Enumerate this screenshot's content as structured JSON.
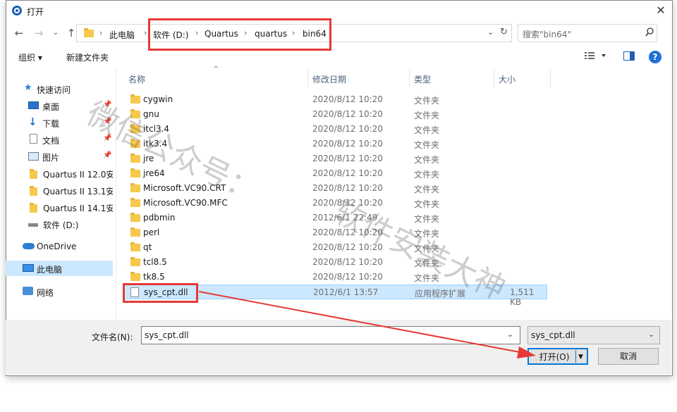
{
  "window": {
    "title": "打开"
  },
  "address": {
    "crumbs": [
      "此电脑",
      "软件 (D:)",
      "Quartus",
      "quartus",
      "bin64"
    ]
  },
  "search": {
    "placeholder": "搜索\"bin64\""
  },
  "toolbar": {
    "organize": "组织 ▾",
    "new_folder": "新建文件夹",
    "help": "?"
  },
  "sidebar": {
    "items": [
      {
        "label": "快速访问",
        "icon": "star-icon"
      },
      {
        "label": "桌面",
        "icon": "desktop-icon"
      },
      {
        "label": "下载",
        "icon": "download-icon"
      },
      {
        "label": "文档",
        "icon": "document-icon"
      },
      {
        "label": "图片",
        "icon": "picture-icon"
      },
      {
        "label": "Quartus II 12.0安装",
        "icon": "folder-icon"
      },
      {
        "label": "Quartus II 13.1安装",
        "icon": "folder-icon"
      },
      {
        "label": "Quartus II 14.1安装",
        "icon": "folder-icon"
      },
      {
        "label": "软件 (D:)",
        "icon": "drive-icon"
      },
      {
        "label": "OneDrive",
        "icon": "cloud-icon"
      },
      {
        "label": "此电脑",
        "icon": "computer-icon"
      },
      {
        "label": "网络",
        "icon": "network-icon"
      }
    ]
  },
  "columns": {
    "name": "名称",
    "date": "修改日期",
    "type": "类型",
    "size": "大小"
  },
  "files": [
    {
      "name": "cygwin",
      "date": "2020/8/12 10:20",
      "type": "文件夹",
      "size": ""
    },
    {
      "name": "gnu",
      "date": "2020/8/12 10:20",
      "type": "文件夹",
      "size": ""
    },
    {
      "name": "itcl3.4",
      "date": "2020/8/12 10:20",
      "type": "文件夹",
      "size": ""
    },
    {
      "name": "itk3.4",
      "date": "2020/8/12 10:20",
      "type": "文件夹",
      "size": ""
    },
    {
      "name": "jre",
      "date": "2020/8/12 10:20",
      "type": "文件夹",
      "size": ""
    },
    {
      "name": "jre64",
      "date": "2020/8/12 10:20",
      "type": "文件夹",
      "size": ""
    },
    {
      "name": "Microsoft.VC90.CRT",
      "date": "2020/8/12 10:20",
      "type": "文件夹",
      "size": ""
    },
    {
      "name": "Microsoft.VC90.MFC",
      "date": "2020/8/12 10:20",
      "type": "文件夹",
      "size": ""
    },
    {
      "name": "pdbmin",
      "date": "2012/6/1 22:49",
      "type": "文件夹",
      "size": ""
    },
    {
      "name": "perl",
      "date": "2020/8/12 10:20",
      "type": "文件夹",
      "size": ""
    },
    {
      "name": "qt",
      "date": "2020/8/12 10:20",
      "type": "文件夹",
      "size": ""
    },
    {
      "name": "tcl8.5",
      "date": "2020/8/12 10:20",
      "type": "文件夹",
      "size": ""
    },
    {
      "name": "tk8.5",
      "date": "2020/8/12 10:20",
      "type": "文件夹",
      "size": ""
    },
    {
      "name": "sys_cpt.dll",
      "date": "2012/6/1 13:57",
      "type": "应用程序扩展",
      "size": "1,511 KB"
    }
  ],
  "filename": {
    "label": "文件名(N):",
    "value": "sys_cpt.dll"
  },
  "filetype": {
    "value": "sys_cpt.dll"
  },
  "buttons": {
    "open": "打开(O)",
    "cancel": "取消"
  },
  "watermark": {
    "line1": "微信公众号：",
    "line2": "软件安装大神"
  },
  "colors": {
    "accent": "#0078d7",
    "highlight": "#e53935",
    "selection": "#cce8ff"
  }
}
